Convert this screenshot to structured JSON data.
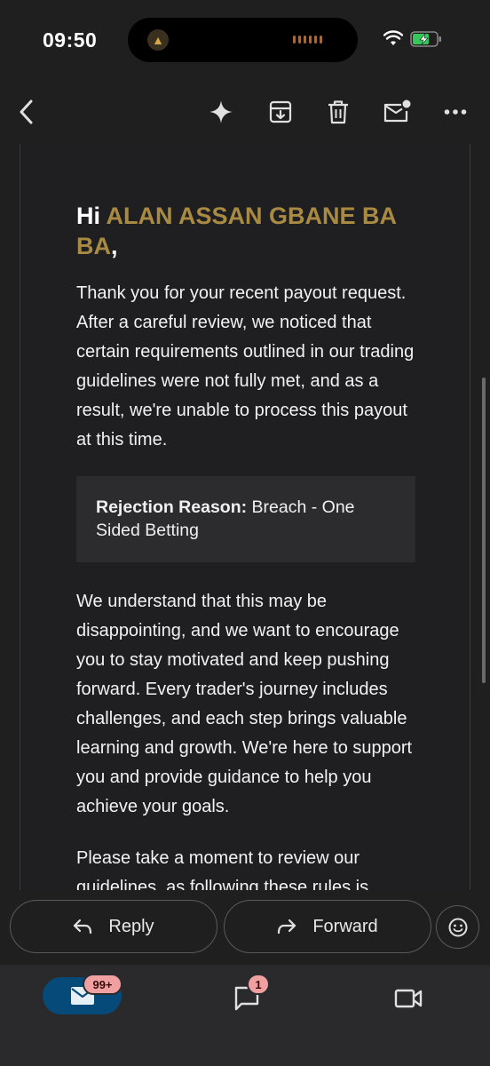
{
  "status_bar": {
    "time": "09:50"
  },
  "app_bar": {
    "icons": [
      "back-arrow-icon",
      "sparkle-icon",
      "archive-icon",
      "trash-icon",
      "mark-unread-icon",
      "more-icon"
    ]
  },
  "email": {
    "greeting_prefix": "Hi ",
    "recipient_name": "ALAN ASSAN GBANE BA BA",
    "greeting_suffix": ",",
    "paragraph_1": "Thank you for your recent payout request. After a careful review, we noticed that certain requirements outlined in our trading guidelines were not fully met, and as a result, we're unable to process this payout at this time.",
    "rejection_label": "Rejection Reason:",
    "rejection_reason": " Breach - One Sided Betting",
    "paragraph_2": "We understand that this may be disappointing, and we want to encourage you to stay motivated and keep pushing forward. Every trader's journey includes challenges, and each step brings valuable learning and growth. We're here to support you and provide guidance to help you achieve your goals.",
    "paragraph_3": "Please take a moment to review our guidelines, as following these rules is",
    "name_color": "#a88a42"
  },
  "actions": {
    "reply_label": "Reply",
    "forward_label": "Forward"
  },
  "bottom_nav": {
    "mail_badge": "99+",
    "chat_badge": "1",
    "accent_color": "#064a7a"
  }
}
